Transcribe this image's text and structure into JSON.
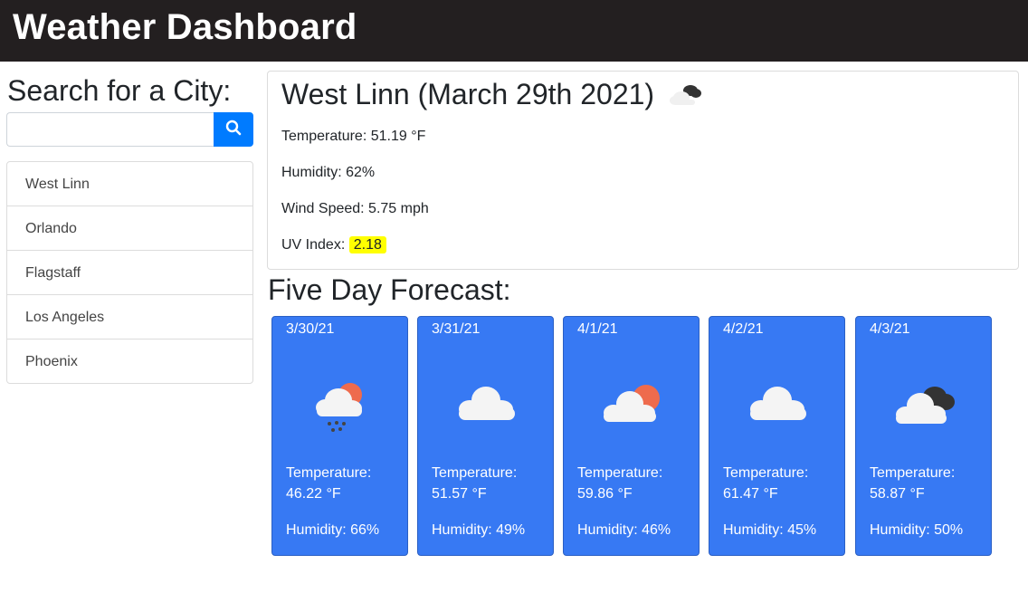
{
  "header": {
    "title": "Weather Dashboard"
  },
  "search": {
    "title": "Search for a City:",
    "input_value": "",
    "placeholder": "",
    "button_icon": "search-icon"
  },
  "history": [
    "West Linn",
    "Orlando",
    "Flagstaff",
    "Los Angeles",
    "Phoenix"
  ],
  "current": {
    "title": "West Linn (March 29th 2021)",
    "icon": "broken-clouds-icon",
    "temperature": "Temperature: 51.19 °F",
    "humidity": "Humidity: 62%",
    "wind": "Wind Speed: 5.75 mph",
    "uv_label": "UV Index:",
    "uv_value": "2.18",
    "uv_color": "#ffff00"
  },
  "forecast": {
    "title": "Five Day Forecast:",
    "card_color": "#3779f3",
    "days": [
      {
        "date": "3/30/21",
        "icon": "rain-sun-icon",
        "temp_label": "Temperature:",
        "temp": "46.22 °F",
        "humidity": "Humidity: 66%"
      },
      {
        "date": "3/31/21",
        "icon": "cloud-icon",
        "temp_label": "Temperature:",
        "temp": "51.57 °F",
        "humidity": "Humidity: 49%"
      },
      {
        "date": "4/1/21",
        "icon": "partly-cloudy-icon",
        "temp_label": "Temperature:",
        "temp": "59.86 °F",
        "humidity": "Humidity: 46%"
      },
      {
        "date": "4/2/21",
        "icon": "cloud-icon",
        "temp_label": "Temperature:",
        "temp": "61.47 °F",
        "humidity": "Humidity: 45%"
      },
      {
        "date": "4/3/21",
        "icon": "broken-clouds-icon",
        "temp_label": "Temperature:",
        "temp": "58.87 °F",
        "humidity": "Humidity: 50%"
      }
    ]
  }
}
